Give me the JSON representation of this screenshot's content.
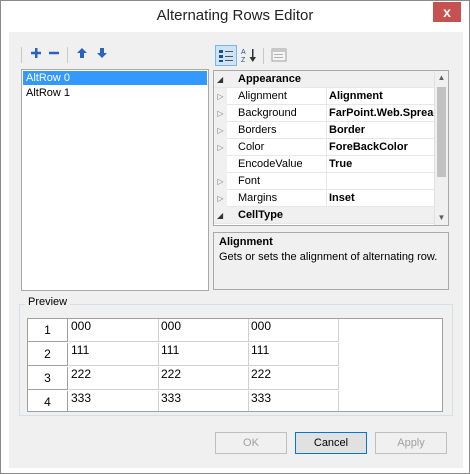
{
  "window": {
    "title": "Alternating Rows Editor",
    "close_glyph": "x"
  },
  "list_toolbar": {
    "add_icon": "add-icon",
    "remove_icon": "remove-icon",
    "move_up_icon": "arrow-up-icon",
    "move_down_icon": "arrow-down-icon"
  },
  "list": {
    "items": [
      "AltRow 0",
      "AltRow 1"
    ],
    "selected_index": 0
  },
  "grid_toolbar": {
    "categorized_icon": "categorized-icon",
    "alphabetical_icon": "sort-alphabetical-icon",
    "property_pages_icon": "property-pages-icon"
  },
  "properties": {
    "category_appearance": "Appearance",
    "rows": [
      {
        "name": "Alignment",
        "value": "Alignment",
        "expandable": true
      },
      {
        "name": "Background",
        "value": "FarPoint.Web.Spread",
        "expandable": true
      },
      {
        "name": "Borders",
        "value": "Border",
        "expandable": true
      },
      {
        "name": "Color",
        "value": "ForeBackColor",
        "expandable": true
      },
      {
        "name": "EncodeValue",
        "value": "True",
        "expandable": false
      },
      {
        "name": "Font",
        "value": "",
        "expandable": true
      },
      {
        "name": "Margins",
        "value": "Inset",
        "expandable": true
      }
    ],
    "category_celltype": "CellType"
  },
  "help": {
    "title": "Alignment",
    "description": "Gets or sets the alignment of alternating row."
  },
  "preview": {
    "label": "Preview",
    "row_headers": [
      "1",
      "2",
      "3",
      "4"
    ],
    "rows": [
      [
        "000",
        "000",
        "000"
      ],
      [
        "111",
        "111",
        "111"
      ],
      [
        "222",
        "222",
        "222"
      ],
      [
        "333",
        "333",
        "333"
      ]
    ]
  },
  "buttons": {
    "ok": "OK",
    "cancel": "Cancel",
    "apply": "Apply"
  },
  "colors": {
    "selection": "#3399ff",
    "close": "#c75050",
    "panel": "#f0f0f0"
  }
}
